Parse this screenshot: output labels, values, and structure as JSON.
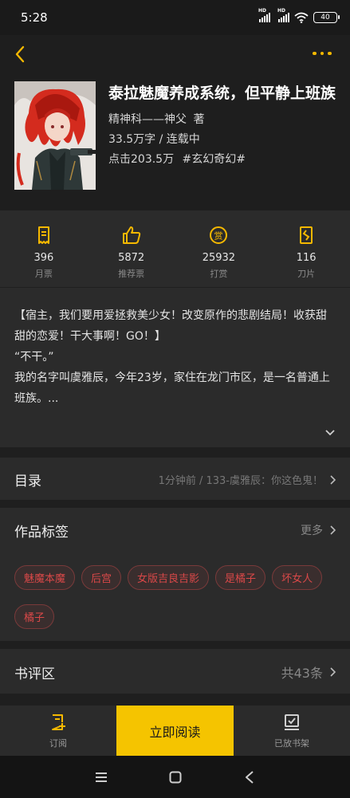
{
  "status_bar": {
    "time": "5:28",
    "network_label_1": "HD",
    "network_label_2": "HD",
    "battery": "40"
  },
  "book": {
    "title": "泰拉魅魔养成系统，但平静上班族",
    "author": "精神科——神父",
    "author_suffix": "著",
    "word_count_status": "33.5万字 / 连载中",
    "clicks": "点击203.5万",
    "genre_tag": "#玄幻奇幻#"
  },
  "stats": [
    {
      "value": "396",
      "label": "月票",
      "icon": "ticket-icon"
    },
    {
      "value": "5872",
      "label": "推荐票",
      "icon": "thumbs-up-icon"
    },
    {
      "value": "25932",
      "label": "打赏",
      "icon": "reward-coin-icon"
    },
    {
      "value": "116",
      "label": "刀片",
      "icon": "blade-icon"
    }
  ],
  "synopsis": {
    "line1": "【宿主，我们要用爱拯救美少女！改变原作的悲剧结局！收获甜甜的恋爱！干大事啊！GO！】",
    "line2": "“不干。”",
    "line3": "我的名字叫虞雅辰，今年23岁，家住在龙门市区，是一名普通上班族。..."
  },
  "catalog": {
    "title": "目录",
    "latest": "1分钟前 / 133-虞雅辰：你这色鬼！"
  },
  "tags_section": {
    "title": "作品标签",
    "more": "更多",
    "tags": [
      "魅魔本魔",
      "后宫",
      "女版吉良吉影",
      "是橘子",
      "坏女人",
      "橘子"
    ]
  },
  "reviews": {
    "title": "书评区",
    "count": "共43条"
  },
  "bottom_bar": {
    "subscribe": "订阅",
    "read_now": "立即阅读",
    "in_shelf": "已放书架"
  },
  "colors": {
    "accent": "#f5c400",
    "tag_text": "#d94848",
    "background": "#1f1f1f",
    "panel": "#2b2b2b"
  }
}
